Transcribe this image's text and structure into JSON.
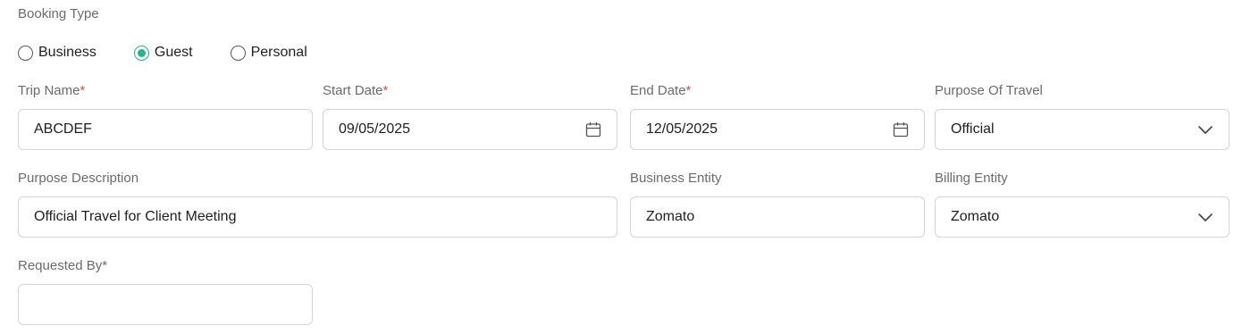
{
  "booking_type": {
    "label": "Booking Type",
    "options": [
      "Business",
      "Guest",
      "Personal"
    ],
    "selected": "Guest"
  },
  "fields": {
    "trip_name": {
      "label": "Trip Name",
      "required": "*",
      "value": "ABCDEF"
    },
    "start_date": {
      "label": "Start Date",
      "required": "*",
      "value": "09/05/2025",
      "icon": "calendar-icon"
    },
    "end_date": {
      "label": "End Date",
      "required": "*",
      "value": "12/05/2025",
      "icon": "calendar-icon"
    },
    "purpose_of_travel": {
      "label": "Purpose Of Travel",
      "value": "Official",
      "icon": "chevron-down-icon"
    },
    "purpose_description": {
      "label": "Purpose Description",
      "value": "Official Travel for Client Meeting"
    },
    "business_entity": {
      "label": "Business Entity",
      "value": "Zomato"
    },
    "billing_entity": {
      "label": "Billing Entity",
      "value": "Zomato",
      "icon": "chevron-down-icon"
    },
    "requested_by": {
      "label": "Requested By",
      "required": "*",
      "value": ""
    }
  },
  "colors": {
    "accent": "#25b48c",
    "required": "#d9534f",
    "border": "#d4d4d4",
    "label": "#6b6b6b"
  }
}
